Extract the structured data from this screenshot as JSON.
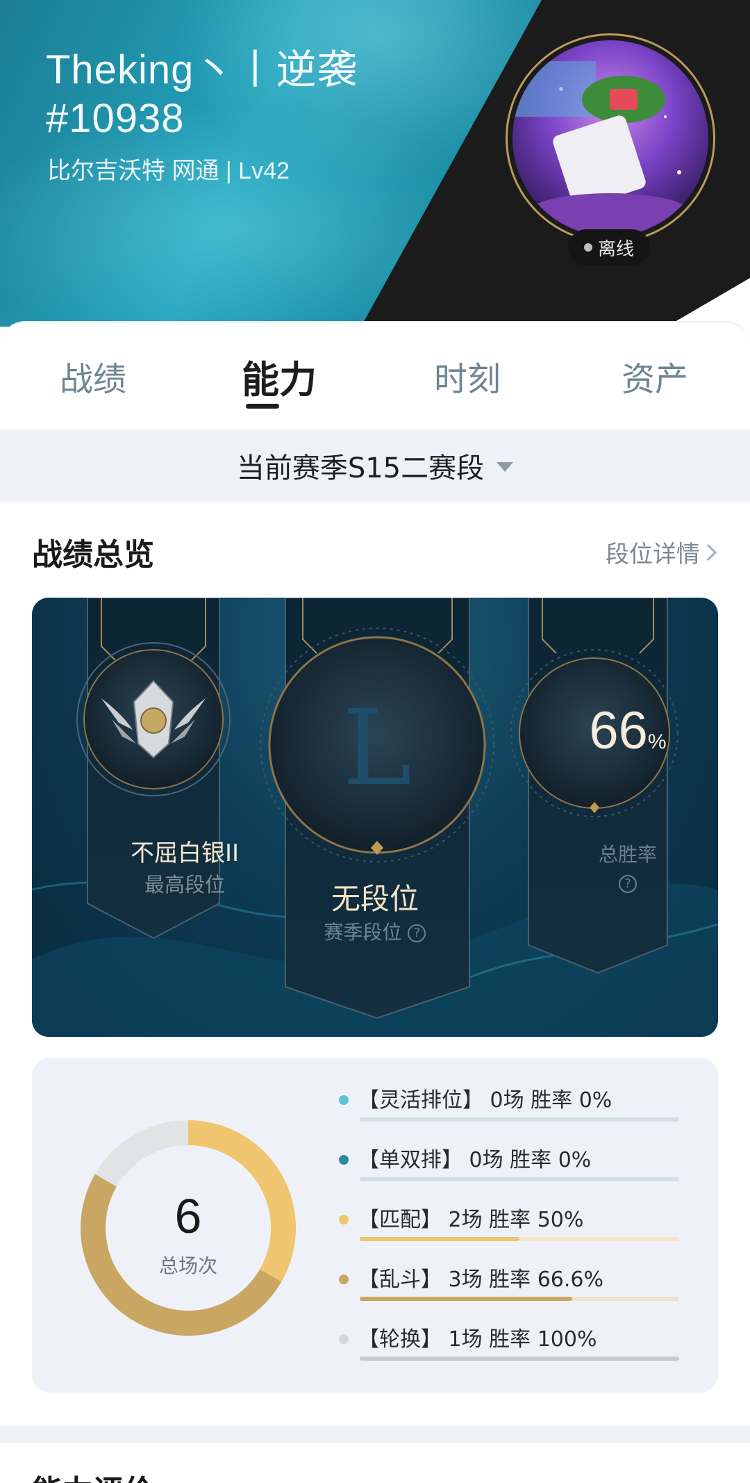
{
  "profile": {
    "name": "Theking丶丨逆袭#10938",
    "server_info": "比尔吉沃特 网通 | Lv42",
    "status": "离线"
  },
  "tabs": [
    {
      "label": "战绩",
      "active": false
    },
    {
      "label": "能力",
      "active": true
    },
    {
      "label": "时刻",
      "active": false
    },
    {
      "label": "资产",
      "active": false
    }
  ],
  "season_selector": {
    "label": "当前赛季S15二赛段"
  },
  "overview": {
    "title": "战绩总览",
    "detail_link": "段位详情",
    "best_rank": {
      "name": "不屈白银II",
      "label": "最高段位"
    },
    "season_rank": {
      "name": "无段位",
      "label": "赛季段位"
    },
    "win_rate": {
      "value": "66",
      "unit": "%",
      "label": "总胜率"
    }
  },
  "stats": {
    "total_games": "6",
    "total_label": "总场次",
    "modes": [
      {
        "text": "【灵活排位】 0场   胜率 0%",
        "games": 0,
        "win_rate": 0,
        "color": "#5cc3d2"
      },
      {
        "text": "【单双排】 0场   胜率 0%",
        "games": 0,
        "win_rate": 0,
        "color": "#2a8c99"
      },
      {
        "text": "【匹配】 2场   胜率 50%",
        "games": 2,
        "win_rate": 50,
        "color": "#f0c570"
      },
      {
        "text": "【乱斗】 3场   胜率 66.6%",
        "games": 3,
        "win_rate": 66.6,
        "color": "#c9a661"
      },
      {
        "text": "【轮换】 1场   胜率 100%",
        "games": 1,
        "win_rate": 100,
        "color": "#d4d6d9"
      }
    ]
  },
  "ability": {
    "title": "能力评价"
  }
}
